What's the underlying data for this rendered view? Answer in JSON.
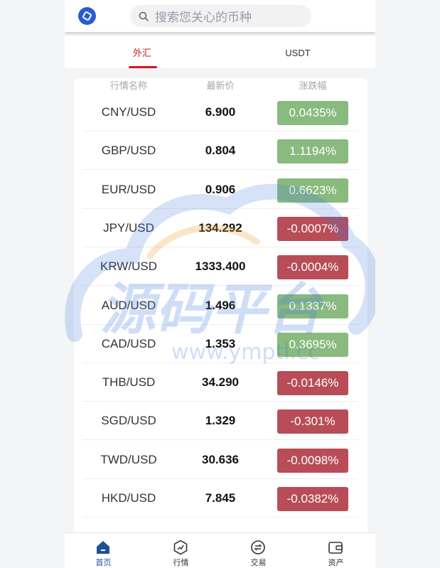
{
  "search": {
    "placeholder": "搜索您关心的币种"
  },
  "tabs": [
    {
      "label": "外汇",
      "active": true
    },
    {
      "label": "USDT",
      "active": false
    }
  ],
  "table": {
    "headers": [
      "行情名称",
      "最新价",
      "涨跌幅"
    ],
    "rows": [
      {
        "pair": "CNY/USD",
        "price": "6.900",
        "change": "0.0435%",
        "direction": "up"
      },
      {
        "pair": "GBP/USD",
        "price": "0.804",
        "change": "1.1194%",
        "direction": "up"
      },
      {
        "pair": "EUR/USD",
        "price": "0.906",
        "change": "0.6623%",
        "direction": "up"
      },
      {
        "pair": "JPY/USD",
        "price": "134.292",
        "change": "-0.0007%",
        "direction": "down"
      },
      {
        "pair": "KRW/USD",
        "price": "1333.400",
        "change": "-0.0004%",
        "direction": "down"
      },
      {
        "pair": "AUD/USD",
        "price": "1.496",
        "change": "0.1337%",
        "direction": "up"
      },
      {
        "pair": "CAD/USD",
        "price": "1.353",
        "change": "0.3695%",
        "direction": "up"
      },
      {
        "pair": "THB/USD",
        "price": "34.290",
        "change": "-0.0146%",
        "direction": "down"
      },
      {
        "pair": "SGD/USD",
        "price": "1.329",
        "change": "-0.301%",
        "direction": "down"
      },
      {
        "pair": "TWD/USD",
        "price": "30.636",
        "change": "-0.0098%",
        "direction": "down"
      },
      {
        "pair": "HKD/USD",
        "price": "7.845",
        "change": "-0.0382%",
        "direction": "down"
      }
    ]
  },
  "watermark": {
    "text": "源码平台",
    "url": "www.ymptl.cc"
  },
  "bottom_nav": [
    {
      "label": "首页",
      "icon": "home-icon",
      "active": true
    },
    {
      "label": "行情",
      "icon": "market-icon",
      "active": false
    },
    {
      "label": "交易",
      "icon": "exchange-icon",
      "active": false
    },
    {
      "label": "资产",
      "icon": "wallet-icon",
      "active": false
    }
  ],
  "colors": {
    "up": "#89ba7e",
    "down": "#b84d57",
    "accent": "#d2191f",
    "brand": "#2a5bd7"
  }
}
